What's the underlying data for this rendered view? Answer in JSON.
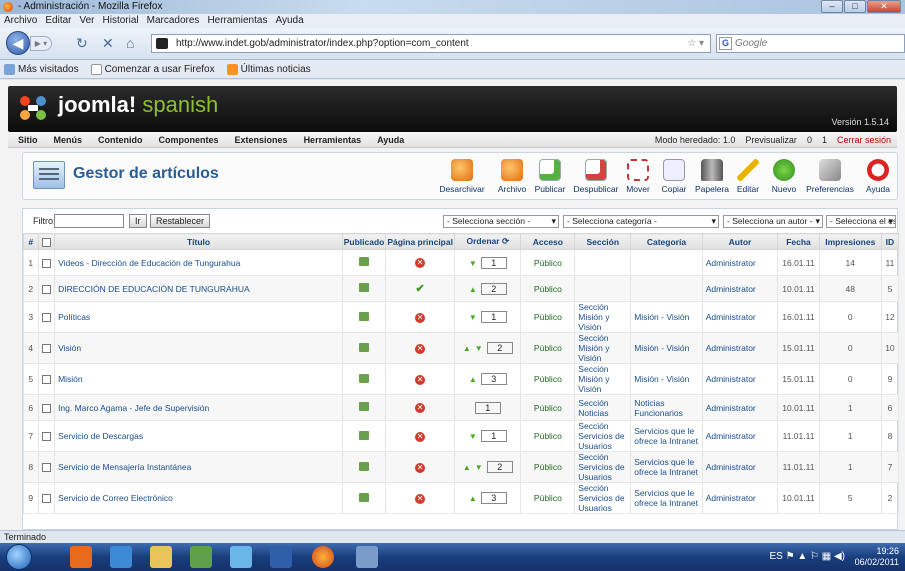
{
  "browser": {
    "title": "- Administración - Mozilla Firefox",
    "menu": [
      "Archivo",
      "Editar",
      "Ver",
      "Historial",
      "Marcadores",
      "Herramientas",
      "Ayuda"
    ],
    "url": "http://www.indet.gob/administrator/index.php?option=com_content",
    "search_placeholder": "Google",
    "bookmarks": [
      "Más visitados",
      "Comenzar a usar Firefox",
      "Últimas noticias"
    ],
    "status": "Terminado"
  },
  "joomla": {
    "logo_text": "joomla!",
    "logo_suffix": "spanish",
    "version": "Versión 1.5.14",
    "menu": [
      "Sitio",
      "Menús",
      "Contenido",
      "Componentes",
      "Extensiones",
      "Herramientas",
      "Ayuda"
    ],
    "right": {
      "mode": "Modo heredado: 1.0",
      "preview": "Previsualizar",
      "count1": "0",
      "count2": "1",
      "logout": "Cerrar sesión"
    }
  },
  "toolbar": {
    "title": "Gestor de artículos",
    "buttons": [
      "Desarchivar",
      "Archivo",
      "Publicar",
      "Despublicar",
      "Mover",
      "Copiar",
      "Papelera",
      "Editar",
      "Nuevo",
      "Preferencias",
      "Ayuda"
    ]
  },
  "filters": {
    "label": "Filtro:",
    "go": "Ir",
    "reset": "Restablecer",
    "section": "- Selecciona sección -",
    "category": "- Selecciona categoría -",
    "author": "- Selecciona un autor -",
    "state": "- Selecciona el estado -"
  },
  "table": {
    "headers": [
      "#",
      "Título",
      "Publicado",
      "Página principal",
      "Ordenar",
      "Acceso",
      "Sección",
      "Categoría",
      "Autor",
      "Fecha",
      "Impresiones",
      "ID"
    ],
    "rows": [
      {
        "num": "1",
        "title": "Videos - Dirección de Educación de Tungurahua",
        "front": "no",
        "order": "1",
        "up": false,
        "down": true,
        "access": "Público",
        "section": "",
        "category": "",
        "author": "Administrator",
        "date": "16.01.11",
        "hits": "14",
        "id": "11"
      },
      {
        "num": "2",
        "title": "DIRECCIÓN DE EDUCACIÓN DE TUNGURAHUA",
        "front": "yes",
        "order": "2",
        "up": true,
        "down": false,
        "access": "Público",
        "section": "",
        "category": "",
        "author": "Administrator",
        "date": "10.01.11",
        "hits": "48",
        "id": "5"
      },
      {
        "num": "3",
        "title": "Políticas",
        "front": "no",
        "order": "1",
        "up": false,
        "down": true,
        "access": "Público",
        "section": "Sección Misión y Visión",
        "category": "Misión - Visión",
        "author": "Administrator",
        "date": "16.01.11",
        "hits": "0",
        "id": "12"
      },
      {
        "num": "4",
        "title": "Visión",
        "front": "no",
        "order": "2",
        "up": true,
        "down": true,
        "access": "Público",
        "section": "Sección Misión y Visión",
        "category": "Misión - Visión",
        "author": "Administrator",
        "date": "15.01.11",
        "hits": "0",
        "id": "10"
      },
      {
        "num": "5",
        "title": "Misión",
        "front": "no",
        "order": "3",
        "up": true,
        "down": false,
        "access": "Público",
        "section": "Sección Misión y Visión",
        "category": "Misión - Visión",
        "author": "Administrator",
        "date": "15.01.11",
        "hits": "0",
        "id": "9"
      },
      {
        "num": "6",
        "title": "Ing. Marco Agama - Jefe de Supervisión",
        "front": "no",
        "order": "1",
        "up": false,
        "down": false,
        "access": "Público",
        "section": "Sección Noticias",
        "category": "Noticias Funcionarios",
        "author": "Administrator",
        "date": "10.01.11",
        "hits": "1",
        "id": "6"
      },
      {
        "num": "7",
        "title": "Servicio de Descargas",
        "front": "no",
        "order": "1",
        "up": false,
        "down": true,
        "access": "Público",
        "section": "Sección Servicios de Usuarios",
        "category": "Servicios que le ofrece la Intranet",
        "author": "Administrator",
        "date": "11.01.11",
        "hits": "1",
        "id": "8"
      },
      {
        "num": "8",
        "title": "Servicio de Mensajería Instantánea",
        "front": "no",
        "order": "2",
        "up": true,
        "down": true,
        "access": "Público",
        "section": "Sección Servicios de Usuarios",
        "category": "Servicios que le ofrece la Intranet",
        "author": "Administrator",
        "date": "11.01.11",
        "hits": "1",
        "id": "7"
      },
      {
        "num": "9",
        "title": "Servicio de Correo Electrónico",
        "front": "no",
        "order": "3",
        "up": true,
        "down": false,
        "access": "Público",
        "section": "Sección Servicios de Usuarios",
        "category": "Servicios que le ofrece la Intranet",
        "author": "Administrator",
        "date": "10.01.11",
        "hits": "5",
        "id": "2"
      }
    ]
  },
  "taskbar": {
    "lang": "ES",
    "time": "19:26",
    "date": "06/02/2011"
  }
}
